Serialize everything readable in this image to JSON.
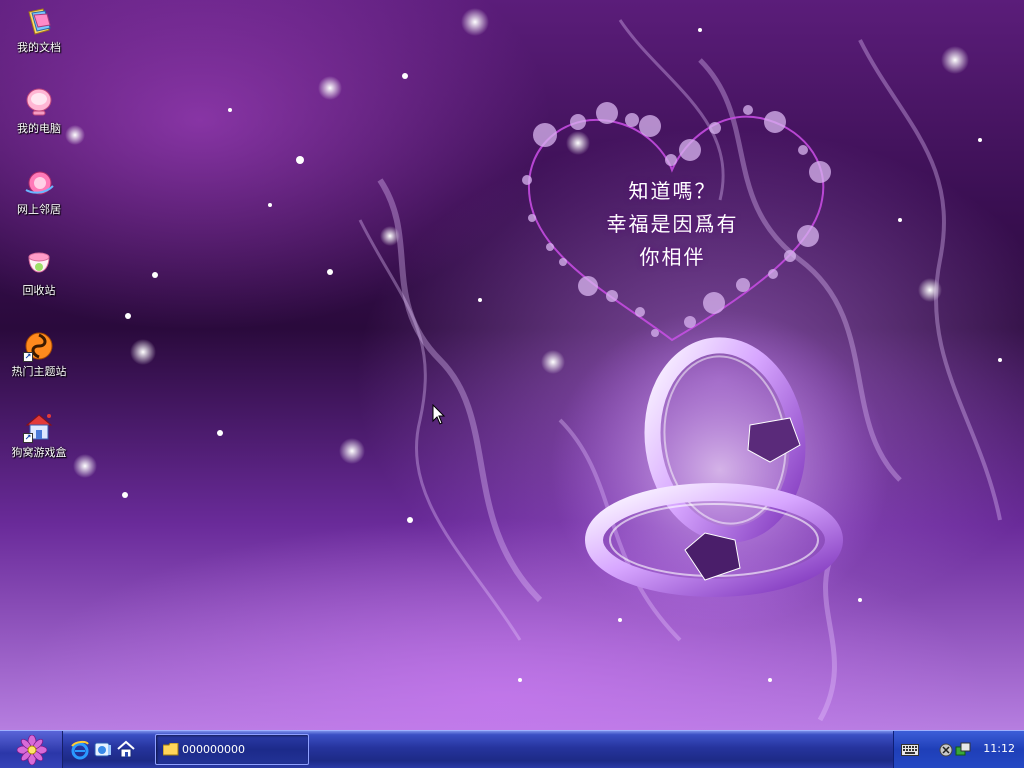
{
  "desktop": {
    "icons": [
      {
        "label": "我的文档",
        "icon": "my-documents-icon"
      },
      {
        "label": "我的电脑",
        "icon": "my-computer-icon"
      },
      {
        "label": "网上邻居",
        "icon": "network-icon"
      },
      {
        "label": "回收站",
        "icon": "recycle-bin-icon"
      },
      {
        "label": "热门主题站",
        "icon": "theme-site-icon"
      },
      {
        "label": "狗窝游戏盒",
        "icon": "game-box-icon"
      }
    ],
    "wallpaper": {
      "heart_text": [
        "知道嗎？",
        "幸福是因爲有",
        "你相伴"
      ],
      "accent": "#b56ee8"
    }
  },
  "taskbar": {
    "start_icon": "flower-start-icon",
    "quick_launch": [
      "ie-icon",
      "media-icon",
      "home-icon"
    ],
    "task_label": "000000000",
    "tray_icons": [
      "keyboard-icon",
      "volume-icon",
      "network-status-icon"
    ],
    "clock": "11:12",
    "colors": {
      "bar": "#26349d",
      "tray": "#1f3fb8"
    }
  }
}
